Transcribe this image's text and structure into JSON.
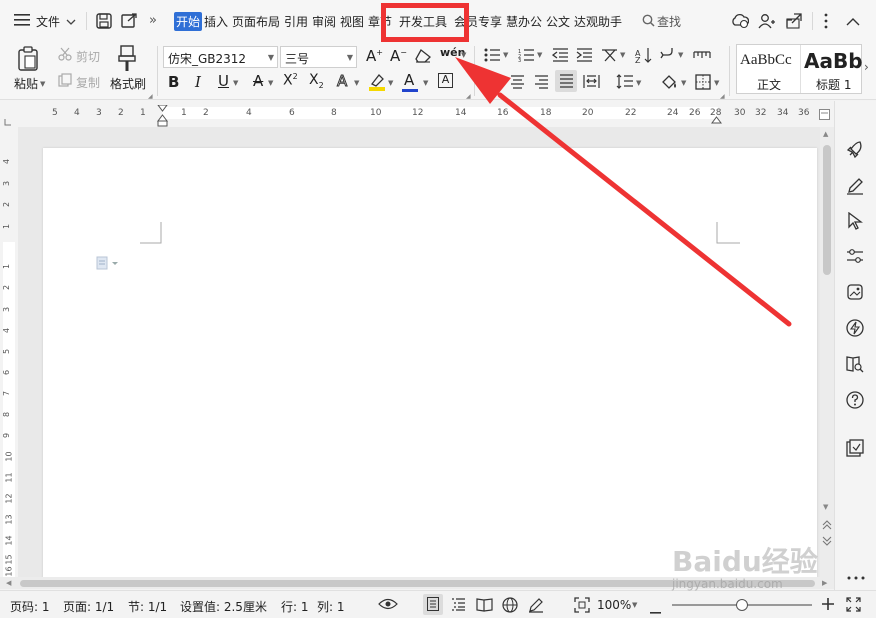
{
  "menubar": {
    "file_label": "文件",
    "tabs": [
      "开始",
      "插入",
      "页面布局",
      "引用",
      "审阅",
      "视图",
      "章节",
      "开发工具",
      "会员专享",
      "慧办公",
      "公文",
      "达观助手"
    ],
    "search_label": "查找"
  },
  "ribbon": {
    "paste_label": "粘贴",
    "cut_label": "剪切",
    "copy_label": "复制",
    "format_painter_label": "格式刷",
    "font_name": "仿宋_GB2312",
    "font_size": "三号",
    "style_normal_preview": "AaBbCc",
    "style_normal_label": "正文",
    "style_heading_preview": "AaBb",
    "style_heading_label": "标题 1"
  },
  "ruler": {
    "h_numbers": [
      "5",
      "4",
      "3",
      "2",
      "1",
      "1",
      "2",
      "4",
      "6",
      "8",
      "10",
      "12",
      "14",
      "16",
      "18",
      "20",
      "22",
      "24",
      "26",
      "28",
      "30",
      "32",
      "34",
      "36",
      "38",
      "39"
    ],
    "v_numbers": [
      "4",
      "3",
      "2",
      "1",
      "1",
      "2",
      "3",
      "4",
      "5",
      "6",
      "7",
      "8",
      "9",
      "10",
      "11",
      "12",
      "13",
      "14",
      "15",
      "16"
    ]
  },
  "status": {
    "page": "页码: 1",
    "pages": "页面: 1/1",
    "section": "节: 1/1",
    "setting": "设置值: 2.5厘米",
    "line": "行: 1",
    "column": "列: 1",
    "zoom": "100%",
    "zoom_level": 0.5
  },
  "watermark": {
    "logo": "Baidu经验",
    "url": "jingyan.baidu.com"
  },
  "colors": {
    "accent": "#2f6fd6",
    "highlight_red": "#ee3333",
    "font_color_bar": "#2244cc",
    "highlight_yellow": "#f5d800"
  }
}
